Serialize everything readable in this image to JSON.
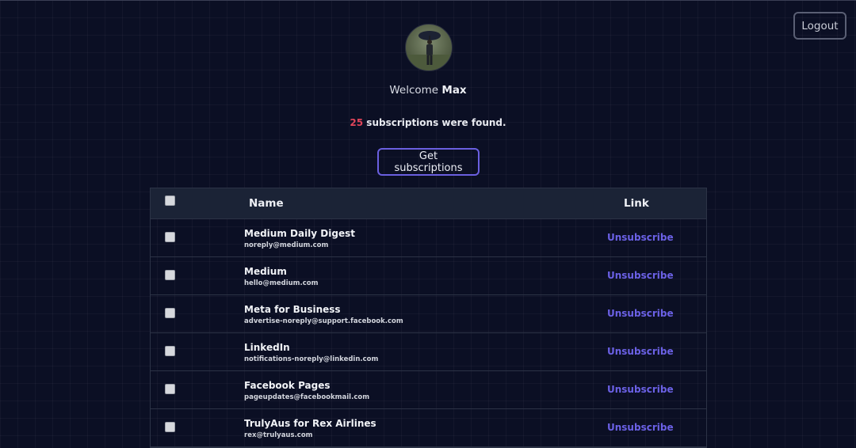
{
  "header": {
    "logout_label": "Logout"
  },
  "profile": {
    "welcome_prefix": "Welcome",
    "user_name": "Max"
  },
  "summary": {
    "count": "25",
    "suffix": "subscriptions were found."
  },
  "actions": {
    "get_subscriptions_label": "Get subscriptions"
  },
  "table": {
    "headers": {
      "name": "Name",
      "link": "Link"
    },
    "rows": [
      {
        "name": "Medium Daily Digest",
        "email": "noreply@medium.com",
        "link_label": "Unsubscribe"
      },
      {
        "name": "Medium",
        "email": "hello@medium.com",
        "link_label": "Unsubscribe"
      },
      {
        "name": "Meta for Business",
        "email": "advertise-noreply@support.facebook.com",
        "link_label": "Unsubscribe"
      },
      {
        "name": "LinkedIn",
        "email": "notifications-noreply@linkedin.com",
        "link_label": "Unsubscribe"
      },
      {
        "name": "Facebook Pages",
        "email": "pageupdates@facebookmail.com",
        "link_label": "Unsubscribe"
      },
      {
        "name": "TrulyAus for Rex Airlines",
        "email": "rex@trulyaus.com",
        "link_label": "Unsubscribe"
      }
    ]
  },
  "colors": {
    "background": "#0b0f24",
    "accent": "#6b61e6",
    "count_highlight": "#e0455a"
  }
}
